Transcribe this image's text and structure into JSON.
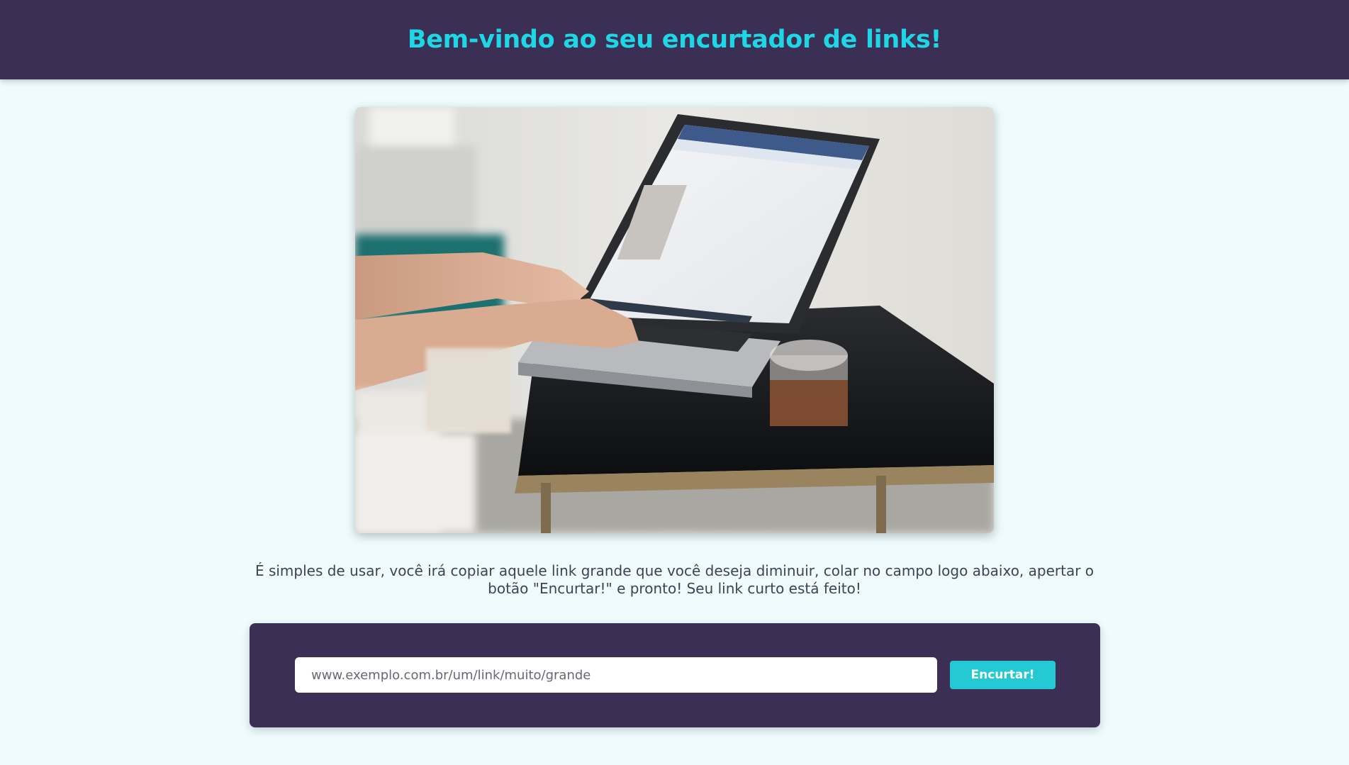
{
  "header": {
    "title": "Bem-vindo ao seu encurtador de links!"
  },
  "hero": {
    "image_name": "laptop-photo"
  },
  "main": {
    "description": "É simples de usar, você irá copiar aquele link grande que você deseja diminuir, colar no campo logo abaixo, apertar o botão \"Encurtar!\" e pronto! Seu link curto está feito!"
  },
  "form": {
    "url_placeholder": "www.exemplo.com.br/um/link/muito/grande",
    "url_value": "",
    "shorten_label": "Encurtar!"
  },
  "colors": {
    "header_bg": "#3b2f55",
    "title": "#1fd6e4",
    "page_bg": "#eefcfd",
    "button": "#24c9d4"
  }
}
